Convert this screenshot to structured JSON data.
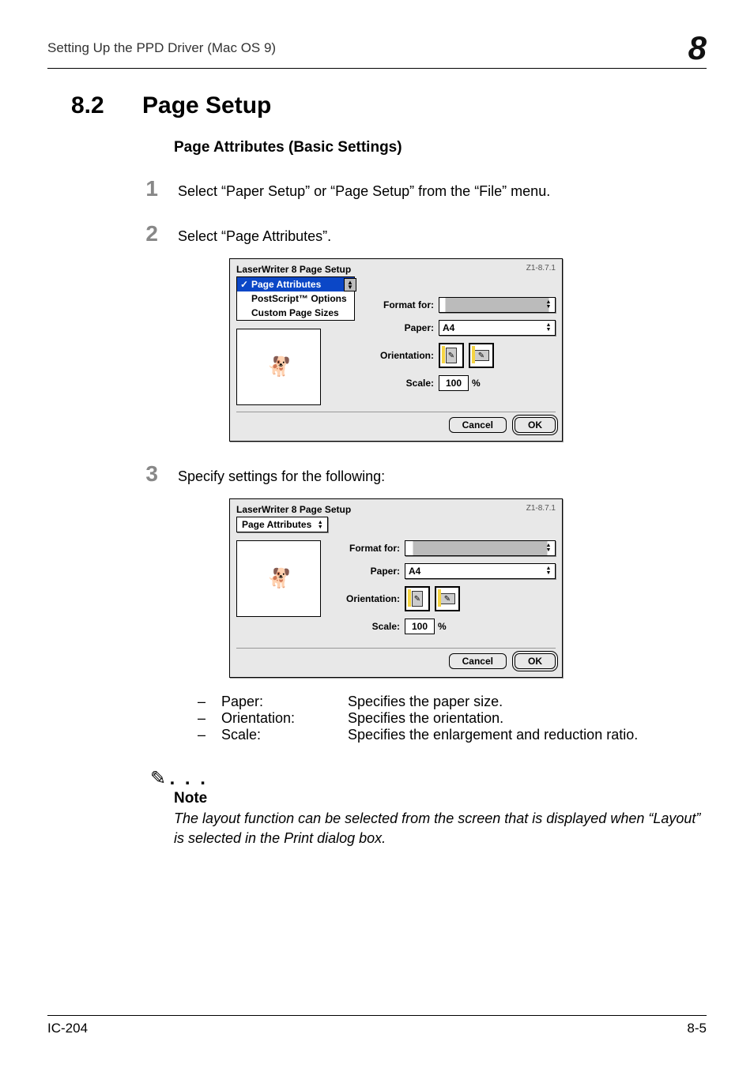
{
  "header": {
    "running_title": "Setting Up the PPD Driver (Mac OS 9)",
    "chapter_number": "8"
  },
  "section": {
    "number": "8.2",
    "title": "Page Setup",
    "subheading": "Page Attributes (Basic Settings)"
  },
  "steps": {
    "s1": {
      "num": "1",
      "text": "Select “Paper Setup” or “Page Setup” from the “File” menu."
    },
    "s2": {
      "num": "2",
      "text": "Select “Page Attributes”."
    },
    "s3": {
      "num": "3",
      "text": "Specify settings for the following:"
    }
  },
  "dialog1": {
    "title": "LaserWriter 8 Page Setup",
    "version": "Z1-8.7.1",
    "menu": {
      "selected": "Page Attributes",
      "items": [
        "PostScript™ Options",
        "Custom Page Sizes"
      ]
    },
    "labels": {
      "format_for": "Format for:",
      "paper": "Paper:",
      "orientation": "Orientation:",
      "scale": "Scale:"
    },
    "paper_value": "A4",
    "scale_value": "100",
    "scale_unit": "%",
    "buttons": {
      "cancel": "Cancel",
      "ok": "OK"
    }
  },
  "dialog2": {
    "title": "LaserWriter 8 Page Setup",
    "version": "Z1-8.7.1",
    "dropdown_value": "Page Attributes",
    "labels": {
      "format_for": "Format for:",
      "paper": "Paper:",
      "orientation": "Orientation:",
      "scale": "Scale:"
    },
    "paper_value": "A4",
    "scale_value": "100",
    "scale_unit": "%",
    "buttons": {
      "cancel": "Cancel",
      "ok": "OK"
    }
  },
  "definitions": {
    "paper": {
      "term": "Paper:",
      "desc": "Specifies the paper size."
    },
    "orientation": {
      "term": "Orientation:",
      "desc": "Specifies the orientation."
    },
    "scale": {
      "term": "Scale:",
      "desc": "Specifies the enlargement and reduction ratio."
    }
  },
  "note": {
    "label": "Note",
    "text": "The layout function can be selected from the screen that is displayed when “Layout” is selected in the Print dialog box."
  },
  "footer": {
    "left": "IC-204",
    "right": "8-5"
  }
}
